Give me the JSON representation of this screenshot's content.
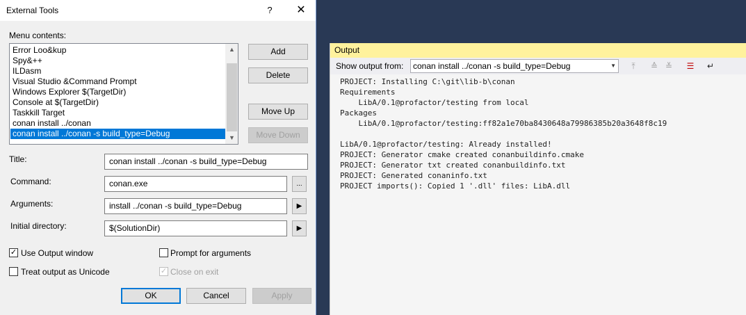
{
  "dialog": {
    "title": "External Tools",
    "help_label": "?",
    "close_label": "✕",
    "menu_contents_label": "Menu contents:",
    "menu_items": [
      "Error Loo&kup",
      "Spy&++",
      "ILDasm",
      "Visual Studio &Command Prompt",
      "Windows Explorer $(TargetDir)",
      "Console at $(TargetDir)",
      "Taskkill Target",
      "conan install ../conan",
      "conan install ../conan -s build_type=Debug"
    ],
    "selected_item": "conan install ../conan -s build_type=Debug",
    "buttons": {
      "add": "Add",
      "delete": "Delete",
      "move_up": "Move Up",
      "move_down": "Move Down",
      "ok": "OK",
      "cancel": "Cancel",
      "apply": "Apply"
    },
    "fields": {
      "title_label": "Title:",
      "title_value": "conan install ../conan -s build_type=Debug",
      "command_label": "Command:",
      "command_value": "conan.exe",
      "browse_label": "...",
      "arguments_label": "Arguments:",
      "arguments_value": "install ../conan -s build_type=Debug",
      "initial_dir_label": "Initial directory:",
      "initial_dir_value": "$(SolutionDir)",
      "expand_label": "▶"
    },
    "checkboxes": {
      "use_output_window": {
        "label": "Use Output window",
        "checked": true,
        "mark": "✓"
      },
      "prompt_for_arguments": {
        "label": "Prompt for arguments",
        "checked": false
      },
      "treat_output_unicode": {
        "label": "Treat output as Unicode",
        "checked": false
      },
      "close_on_exit": {
        "label": "Close on exit",
        "checked": true,
        "disabled": true,
        "mark": "✓"
      }
    }
  },
  "output": {
    "title": "Output",
    "show_output_from_label": "Show output from:",
    "source_value": "conan install ../conan -s build_type=Debug",
    "source_arrow": "▼",
    "toolbar_icons": [
      "goto-previous-icon",
      "find-previous-icon",
      "find-next-icon",
      "clear-all-icon",
      "word-wrap-icon"
    ],
    "lines": [
      "PROJECT: Installing C:\\git\\lib-b\\conan",
      "Requirements",
      "    LibA/0.1@profactor/testing from local",
      "Packages",
      "    LibA/0.1@profactor/testing:ff82a1e70ba8430648a79986385b20a3648f8c19",
      "",
      "LibA/0.1@profactor/testing: Already installed!",
      "PROJECT: Generator cmake created conanbuildinfo.cmake",
      "PROJECT: Generator txt created conanbuildinfo.txt",
      "PROJECT: Generated conaninfo.txt",
      "PROJECT imports(): Copied 1 '.dll' files: LibA.dll"
    ]
  },
  "colors": {
    "background": "#293955",
    "selection": "#0078d7",
    "output_header": "#fff29d"
  }
}
